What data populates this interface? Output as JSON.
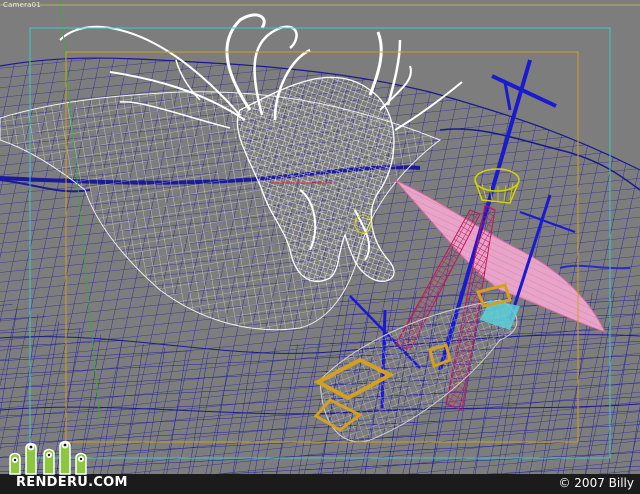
{
  "viewport": {
    "label": "Camera01",
    "background": "#7d7d7d"
  },
  "scene": {
    "objects": [
      {
        "name": "sea-mesh",
        "color": "#1f1f9c"
      },
      {
        "name": "kraken-mesh",
        "color": "#ffffff"
      },
      {
        "name": "ship-hull",
        "color": "#c8c8c8"
      },
      {
        "name": "ship-mast",
        "color": "#1a1ad0"
      },
      {
        "name": "ship-yards",
        "color": "#c2185b"
      },
      {
        "name": "ship-sail",
        "color": "#e8a4c8"
      },
      {
        "name": "crows-nest",
        "color": "#d4d400"
      },
      {
        "name": "deck-frame",
        "color": "#d4a020"
      }
    ],
    "safe_frame_colors": {
      "outer": "#40c8c8",
      "inner": "#d4a020"
    }
  },
  "footer": {
    "site_name": "RENDERU.COM",
    "copyright": "© 2007 Billy",
    "logo_icon": "green-alien-mascots-icon",
    "background": "#1b1b1b"
  }
}
